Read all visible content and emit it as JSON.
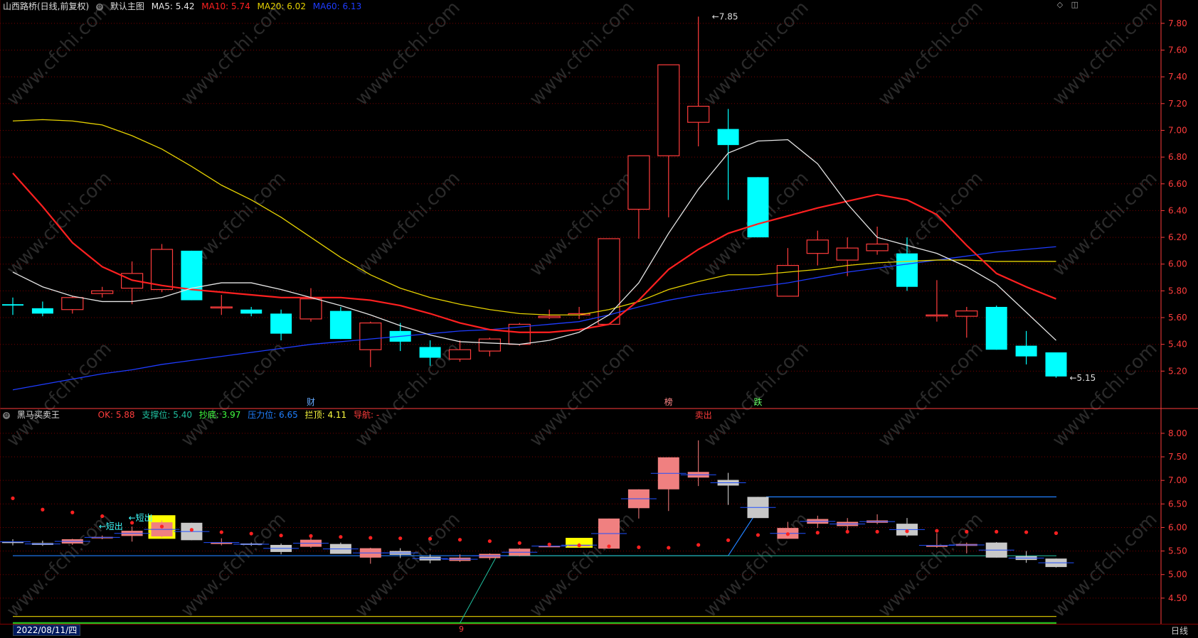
{
  "colors": {
    "up": "#ff3c3c",
    "down": "#00ffff",
    "ma5": "#e6e6e6",
    "ma10": "#ff2020",
    "ma20": "#e6d200",
    "ma60": "#1e3cff",
    "grid": "#7a0000",
    "axis": "#ff3c3c"
  },
  "header": {
    "title": "山西路桥(日线,前复权)",
    "template_label": "默认主图",
    "ma5": "MA5: 5.42",
    "ma10": "MA10: 5.74",
    "ma20": "MA20: 6.02",
    "ma60": "MA60: 6.13"
  },
  "sub_header": {
    "name": "黑马买卖王",
    "ok": "OK: 5.88",
    "support": "支撑位: 5.40",
    "bottom": "抄底: 3.97",
    "pressure": "压力位: 6.65",
    "top": "拦顶: 4.11",
    "guide": "导航: -"
  },
  "top_right_icons": [
    "◇",
    "◫"
  ],
  "bottom_bar": {
    "date": "2022/08/11/四",
    "marker": "9",
    "period": "日线"
  },
  "watermark": "www.cfchi.com",
  "chart_data": [
    {
      "type": "candlestick",
      "panel": "main",
      "ylim": [
        5.0,
        7.9
      ],
      "yticks": [
        "7.80",
        "7.60",
        "7.40",
        "7.20",
        "7.00",
        "6.80",
        "6.60",
        "6.40",
        "6.20",
        "6.00",
        "5.80",
        "5.60",
        "5.40",
        "5.20"
      ],
      "candles": [
        {
          "o": 5.7,
          "c": 5.69,
          "h": 5.75,
          "l": 5.62
        },
        {
          "o": 5.67,
          "c": 5.63,
          "h": 5.72,
          "l": 5.61
        },
        {
          "o": 5.66,
          "c": 5.75,
          "h": 5.76,
          "l": 5.63
        },
        {
          "o": 5.78,
          "c": 5.8,
          "h": 5.83,
          "l": 5.75
        },
        {
          "o": 5.82,
          "c": 5.93,
          "h": 6.02,
          "l": 5.7
        },
        {
          "o": 5.81,
          "c": 6.11,
          "h": 6.15,
          "l": 5.79
        },
        {
          "o": 6.1,
          "c": 5.73,
          "h": 6.1,
          "l": 5.73
        },
        {
          "o": 5.68,
          "c": 5.68,
          "h": 5.77,
          "l": 5.62
        },
        {
          "o": 5.66,
          "c": 5.63,
          "h": 5.68,
          "l": 5.61
        },
        {
          "o": 5.63,
          "c": 5.48,
          "h": 5.66,
          "l": 5.43
        },
        {
          "o": 5.59,
          "c": 5.74,
          "h": 5.82,
          "l": 5.57
        },
        {
          "o": 5.65,
          "c": 5.44,
          "h": 5.68,
          "l": 5.44
        },
        {
          "o": 5.36,
          "c": 5.56,
          "h": 5.57,
          "l": 5.23
        },
        {
          "o": 5.5,
          "c": 5.42,
          "h": 5.56,
          "l": 5.35
        },
        {
          "o": 5.38,
          "c": 5.3,
          "h": 5.43,
          "l": 5.24
        },
        {
          "o": 5.29,
          "c": 5.36,
          "h": 5.43,
          "l": 5.27
        },
        {
          "o": 5.35,
          "c": 5.44,
          "h": 5.45,
          "l": 5.31
        },
        {
          "o": 5.4,
          "c": 5.55,
          "h": 5.56,
          "l": 5.39
        },
        {
          "o": 5.6,
          "c": 5.61,
          "h": 5.66,
          "l": 5.59
        },
        {
          "o": 5.62,
          "c": 5.63,
          "h": 5.68,
          "l": 5.59
        },
        {
          "o": 5.55,
          "c": 6.19,
          "h": 6.19,
          "l": 5.55
        },
        {
          "o": 6.41,
          "c": 6.81,
          "h": 6.81,
          "l": 6.19
        },
        {
          "o": 6.81,
          "c": 7.49,
          "h": 7.49,
          "l": 6.35
        },
        {
          "o": 7.06,
          "c": 7.18,
          "h": 7.85,
          "l": 6.88
        },
        {
          "o": 7.01,
          "c": 6.89,
          "h": 7.16,
          "l": 6.48
        },
        {
          "o": 6.65,
          "c": 6.2,
          "h": 6.65,
          "l": 6.2
        },
        {
          "o": 5.76,
          "c": 5.99,
          "h": 6.12,
          "l": 5.76
        },
        {
          "o": 6.08,
          "c": 6.18,
          "h": 6.25,
          "l": 5.99
        },
        {
          "o": 6.03,
          "c": 6.12,
          "h": 6.2,
          "l": 5.91
        },
        {
          "o": 6.1,
          "c": 6.15,
          "h": 6.28,
          "l": 6.07
        },
        {
          "o": 6.08,
          "c": 5.83,
          "h": 6.2,
          "l": 5.8
        },
        {
          "o": 5.62,
          "c": 5.62,
          "h": 5.88,
          "l": 5.57
        },
        {
          "o": 5.61,
          "c": 5.65,
          "h": 5.68,
          "l": 5.45
        },
        {
          "o": 5.68,
          "c": 5.36,
          "h": 5.69,
          "l": 5.36
        },
        {
          "o": 5.39,
          "c": 5.31,
          "h": 5.5,
          "l": 5.25
        },
        {
          "o": 5.34,
          "c": 5.16,
          "h": 5.34,
          "l": 5.15
        }
      ],
      "ma5": [
        5.94,
        5.83,
        5.76,
        5.72,
        5.72,
        5.75,
        5.82,
        5.86,
        5.86,
        5.81,
        5.75,
        5.69,
        5.62,
        5.54,
        5.47,
        5.42,
        5.41,
        5.4,
        5.43,
        5.49,
        5.62,
        5.86,
        6.23,
        6.56,
        6.83,
        6.92,
        6.93,
        6.75,
        6.45,
        6.2,
        6.14,
        6.08,
        5.98,
        5.85,
        5.64,
        5.43
      ],
      "ma10": [
        6.68,
        6.43,
        6.16,
        5.98,
        5.88,
        5.84,
        5.81,
        5.79,
        5.77,
        5.75,
        5.75,
        5.75,
        5.73,
        5.69,
        5.63,
        5.56,
        5.51,
        5.49,
        5.49,
        5.51,
        5.55,
        5.73,
        5.96,
        6.11,
        6.23,
        6.3,
        6.36,
        6.42,
        6.47,
        6.52,
        6.48,
        6.37,
        6.14,
        5.93,
        5.83,
        5.74
      ],
      "ma20": [
        7.07,
        7.08,
        7.07,
        7.04,
        6.96,
        6.86,
        6.73,
        6.59,
        6.48,
        6.35,
        6.2,
        6.05,
        5.92,
        5.82,
        5.75,
        5.7,
        5.66,
        5.63,
        5.62,
        5.62,
        5.66,
        5.72,
        5.81,
        5.87,
        5.92,
        5.92,
        5.94,
        5.96,
        5.99,
        6.01,
        6.02,
        6.03,
        6.03,
        6.02,
        6.02,
        6.02
      ],
      "ma60": [
        5.06,
        5.1,
        5.14,
        5.18,
        5.21,
        5.25,
        5.28,
        5.31,
        5.34,
        5.37,
        5.4,
        5.42,
        5.44,
        5.46,
        5.48,
        5.5,
        5.51,
        5.53,
        5.55,
        5.57,
        5.62,
        5.68,
        5.73,
        5.77,
        5.8,
        5.83,
        5.86,
        5.9,
        5.94,
        5.97,
        6.0,
        6.03,
        6.06,
        6.09,
        6.11,
        6.13
      ],
      "annotations": [
        {
          "i": 23,
          "price": 7.85,
          "text": "7.85"
        },
        {
          "i": 35,
          "price": 5.15,
          "text": "5.15"
        }
      ],
      "event_labels": [
        {
          "i": 10,
          "text": "财",
          "color": "#66aaff"
        },
        {
          "i": 22,
          "text": "榜",
          "color": "#ff8888"
        },
        {
          "i": 25,
          "text": "跌",
          "color": "#66ff66"
        }
      ]
    },
    {
      "type": "candlestick",
      "panel": "sub",
      "ylim": [
        4.0,
        8.3
      ],
      "yticks": [
        "8.00",
        "7.50",
        "7.00",
        "6.50",
        "6.00",
        "5.50",
        "5.00",
        "4.50"
      ],
      "candles_ref": "main",
      "support": 5.4,
      "pressure": 6.65,
      "bottom": 3.97,
      "top": 4.11,
      "highlight_yellow": [
        5,
        19
      ],
      "dots": [
        6.62,
        6.38,
        6.32,
        6.24,
        6.1,
        6.02,
        5.95,
        5.9,
        5.87,
        5.83,
        5.82,
        5.8,
        5.78,
        5.77,
        5.76,
        5.74,
        5.71,
        5.67,
        5.64,
        5.62,
        5.6,
        5.58,
        5.57,
        5.63,
        5.73,
        5.84,
        5.86,
        5.89,
        5.91,
        5.91,
        5.92,
        5.93,
        5.91,
        5.91,
        5.9,
        5.88
      ],
      "labels": [
        {
          "i": 3,
          "price": 6.02,
          "text": "←短出"
        },
        {
          "i": 4,
          "price": 6.2,
          "text": "←短出"
        },
        {
          "i": 23,
          "price": 8.38,
          "text": "卖出"
        }
      ]
    }
  ]
}
